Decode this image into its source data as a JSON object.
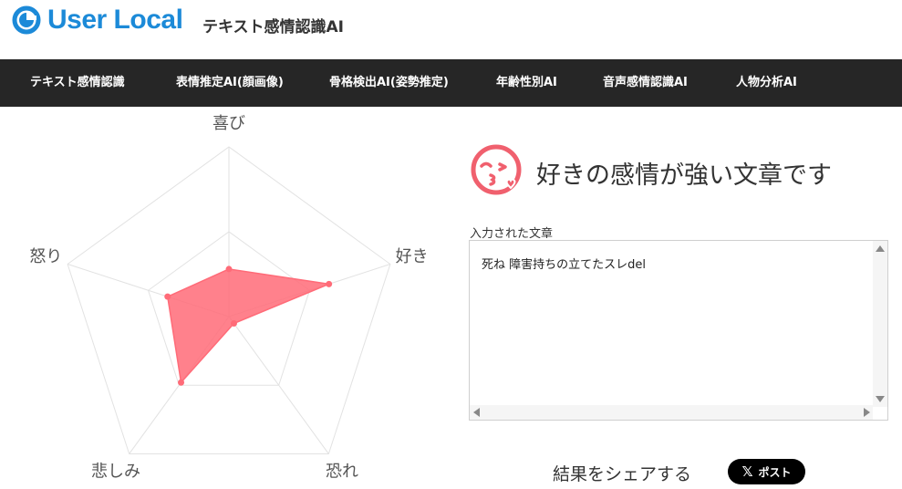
{
  "header": {
    "brand": "User Local",
    "app_title": "テキスト感情認識AI",
    "brand_color": "#1c8ad8"
  },
  "nav": {
    "items": [
      {
        "label": "テキスト感情認識"
      },
      {
        "label": "表情推定AI(顔画像)"
      },
      {
        "label": "骨格検出AI(姿勢推定)"
      },
      {
        "label": "年齢性別AI"
      },
      {
        "label": "音声感情認識AI"
      },
      {
        "label": "人物分析AI"
      }
    ]
  },
  "result": {
    "title": "好きの感情が強い文章です",
    "icon": "kissing-face-icon",
    "accent_color": "#f0606e"
  },
  "input": {
    "label": "入力された文章",
    "value": "死ね 障害持ちの立てたスレdel"
  },
  "share": {
    "label": "結果をシェアする",
    "button_label": "ポスト"
  },
  "chart_data": {
    "type": "radar",
    "axes": [
      "喜び",
      "好き",
      "恐れ",
      "悲しみ",
      "怒り"
    ],
    "values": [
      0.28,
      0.62,
      0.05,
      0.48,
      0.38
    ],
    "range": [
      0,
      1
    ],
    "grid_levels": 2,
    "fill_color": "#ff6b78",
    "grid_color": "#e2e2e2"
  }
}
